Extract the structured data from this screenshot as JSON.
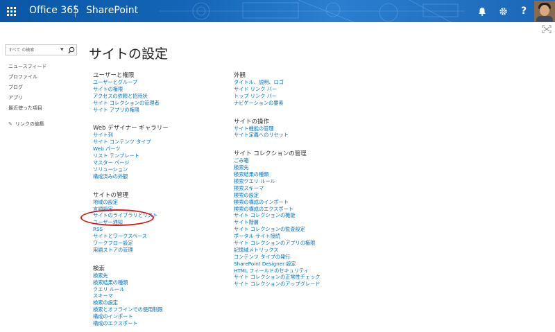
{
  "suite": {
    "brand": "Office 365",
    "app": "SharePoint",
    "icons": [
      "waffle-icon",
      "bell-icon",
      "gear-icon",
      "help-icon"
    ],
    "help_label": "?"
  },
  "search": {
    "placeholder": "すべて の検索"
  },
  "leftnav": {
    "items": [
      "ニュースフィード",
      "プロファイル",
      "ブログ",
      "アプリ",
      "最近使った項目"
    ],
    "edit_links": "リンクの編集"
  },
  "page_title": "サイトの設定",
  "left_column": [
    {
      "heading": "ユーザーと権限",
      "links": [
        "ユーザーとグループ",
        "サイトの権限",
        "アクセスの依頼と招待状",
        "サイト コレクションの管理者",
        "サイト アプリの権限"
      ]
    },
    {
      "heading": "Web デザイナー ギャラリー",
      "links": [
        "サイト列",
        "サイト コンテンツ タイプ",
        "Web パーツ",
        "リスト テンプレート",
        "マスター ページ",
        "ソリューション",
        "構成済みの外観"
      ]
    },
    {
      "heading": "サイトの管理",
      "links": [
        "地域の設定",
        "言語設定",
        "サイトのライブラリとリスト",
        "ユーザー通知",
        "RSS",
        "サイトとワークスペース",
        "ワークフロー設定",
        "用語ストアの管理"
      ]
    },
    {
      "heading": "検索",
      "links": [
        "検索先",
        "検索結果の種類",
        "クエリ ルール",
        "スキーマ",
        "検索の設定",
        "検索とオフラインでの使用制限",
        "構成のインポート",
        "構成のエクスポート"
      ]
    }
  ],
  "right_column": [
    {
      "heading": "外観",
      "links": [
        "タイトル、説明、ロゴ",
        "サイド リンク バー",
        "トップ リンク バー",
        "ナビゲーションの要素"
      ]
    },
    {
      "heading": "サイトの操作",
      "links": [
        "サイト機能の管理",
        "サイト定義へのリセット"
      ]
    },
    {
      "heading": "サイト コレクションの管理",
      "links": [
        "ごみ箱",
        "検索先",
        "検索結果の種類",
        "検索クエリ ルール",
        "検索スキーマ",
        "検索の設定",
        "検索の構成のインポート",
        "検索の構成のエクスポート",
        "サイト コレクションの機能",
        "サイト階層",
        "サイト コレクションの監査設定",
        "ポータル サイト接続",
        "サイト コレクションのアプリの権限",
        "記憶域メトリックス",
        "コンテンツ タイプの発行",
        "SharePoint Designer 設定",
        "HTML フィールドのセキュリティ",
        "サイト コレクションの正常性チェック",
        "サイト コレクションのアップグレード"
      ]
    }
  ],
  "colors": {
    "suitebar": "#0a57a6",
    "link": "#0072c6",
    "highlight": "#d81818"
  }
}
